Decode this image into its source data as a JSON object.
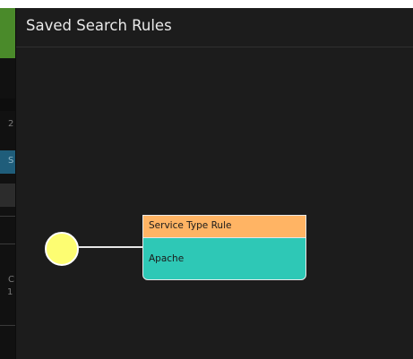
{
  "modal": {
    "title": "Saved Search Rules"
  },
  "underlay": {
    "fragments": [
      "2",
      "S",
      "C",
      "1"
    ]
  },
  "flow": {
    "start_node": {
      "color": "#fdfd72"
    },
    "rule_node": {
      "title": "Service Type Rule",
      "value": "Apache",
      "header_color": "#ffb464",
      "body_color": "#2ec8b6"
    }
  }
}
